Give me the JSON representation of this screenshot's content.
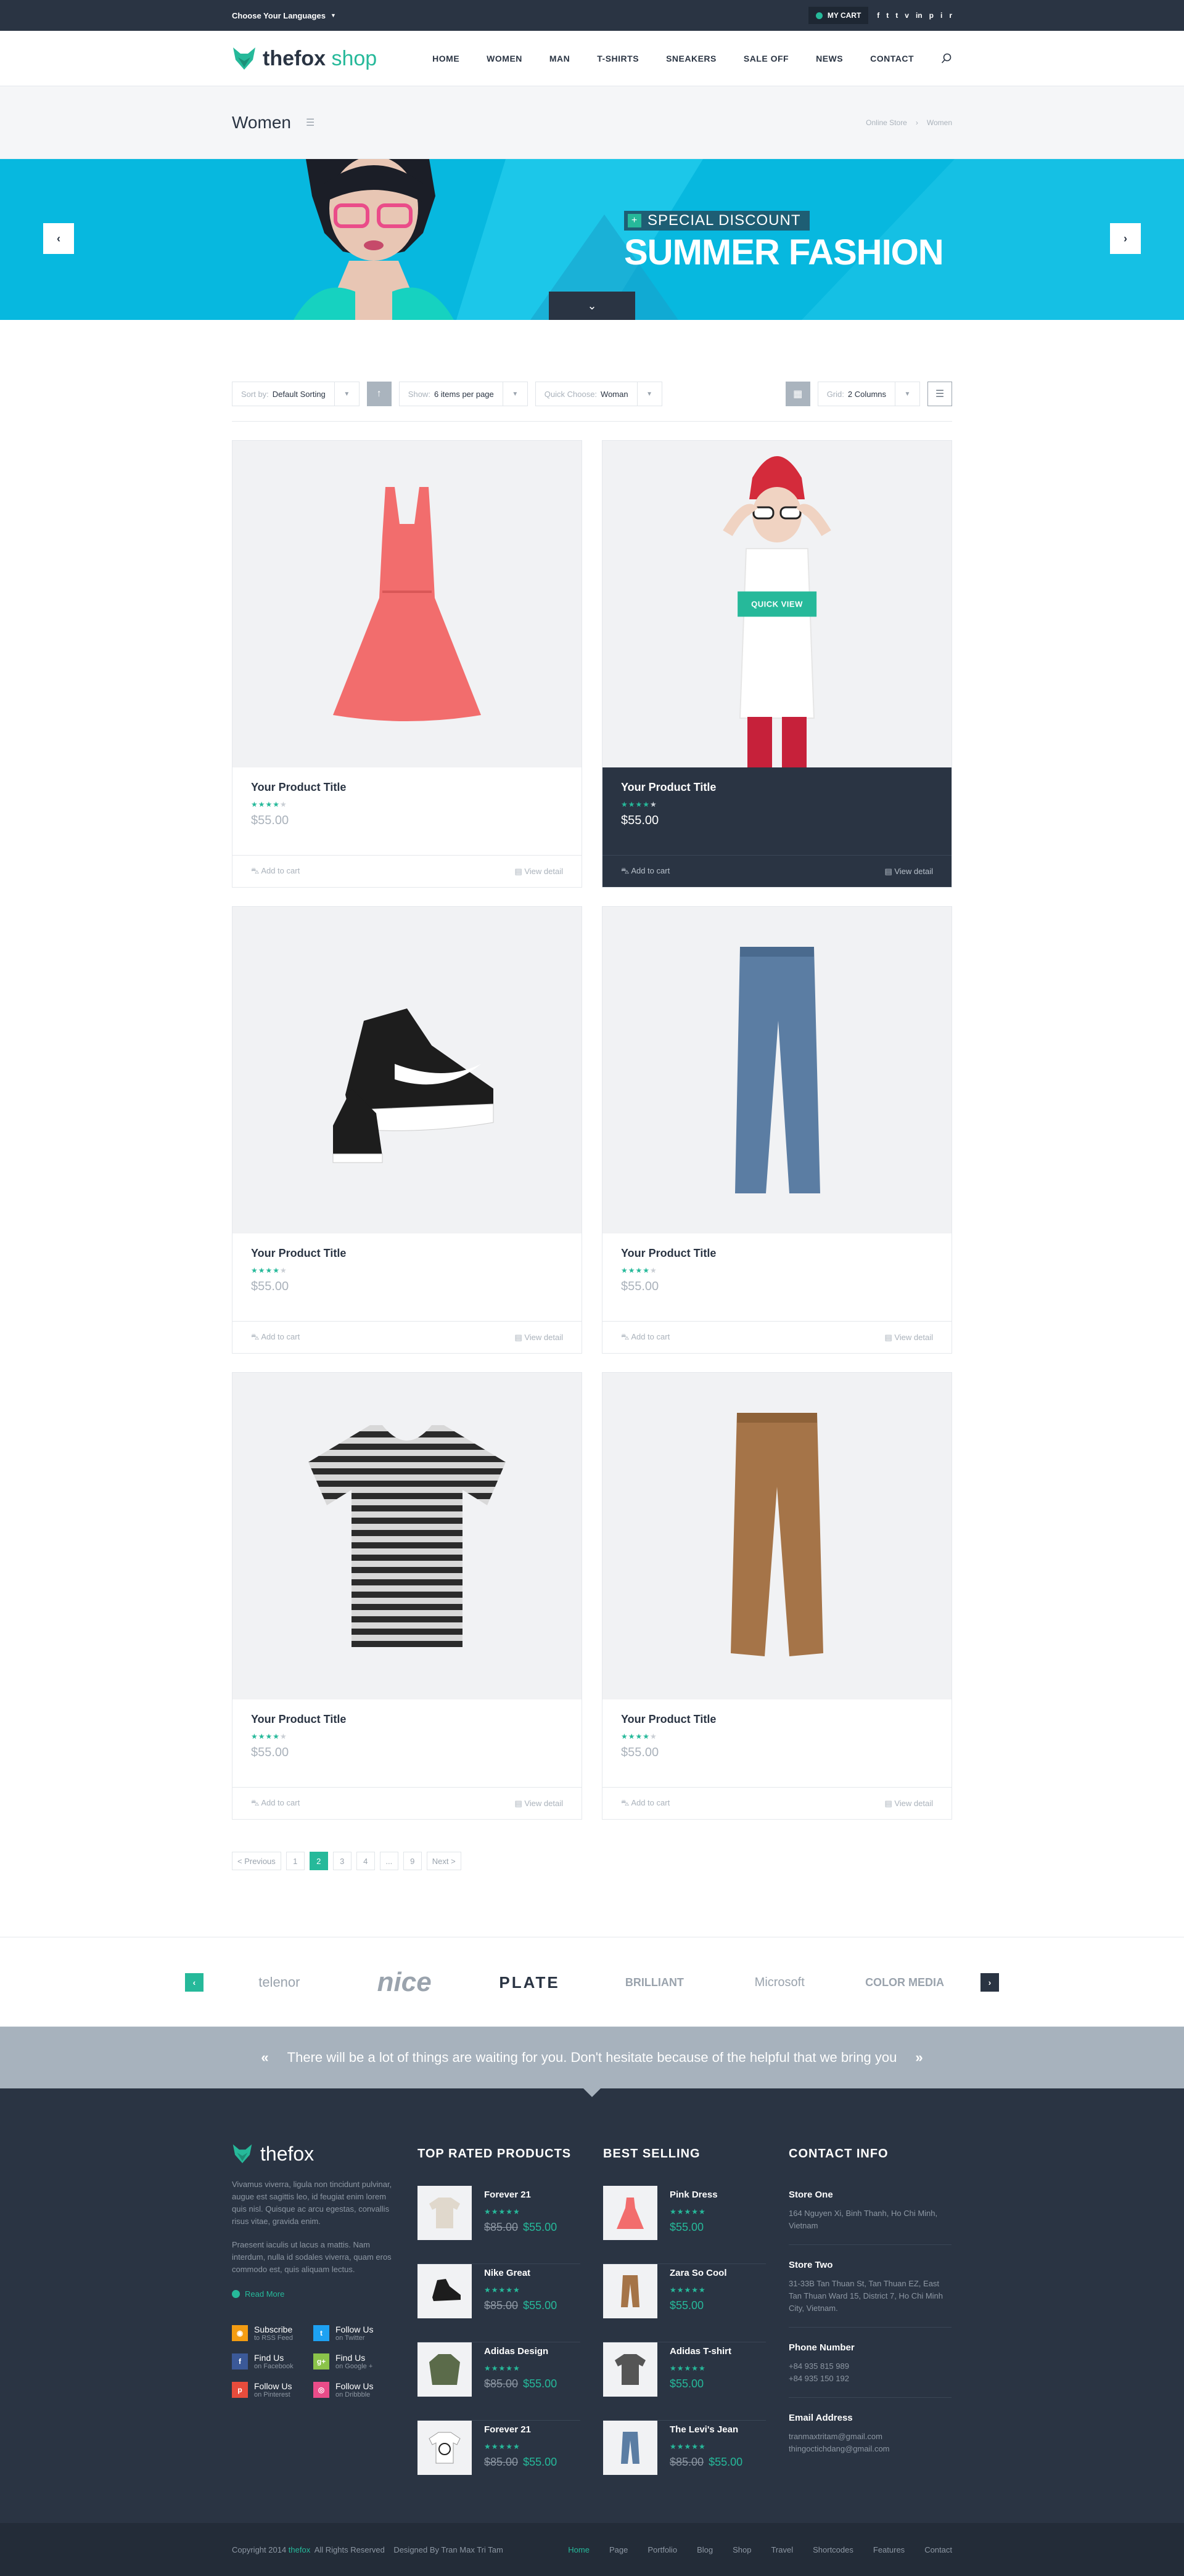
{
  "topbar": {
    "language": "Choose Your Languages",
    "cart": "MY CART",
    "socials": [
      "f",
      "t",
      "t",
      "v",
      "in",
      "p",
      "i",
      "r"
    ]
  },
  "header": {
    "logo_main": "thefox",
    "logo_sub": "shop",
    "nav": [
      "HOME",
      "WOMEN",
      "MAN",
      "T-SHIRTS",
      "SNEAKERS",
      "SALE OFF",
      "NEWS",
      "CONTACT"
    ]
  },
  "page_title": {
    "title": "Women",
    "breadcrumb": [
      "Online Store",
      "Women"
    ]
  },
  "banner": {
    "badge": "SPECIAL DISCOUNT",
    "title": "SUMMER FASHION"
  },
  "toolbar": {
    "sort_label": "Sort by:",
    "sort_value": "Default Sorting",
    "show_label": "Show:",
    "show_value": "6 items per page",
    "quick_label": "Quick Choose:",
    "quick_value": "Woman",
    "grid_label": "Grid:",
    "grid_value": "2 Columns"
  },
  "products": [
    {
      "title": "Your Product Title",
      "price": "$55.00",
      "rating": 4,
      "add": "Add to cart",
      "view": "View detail"
    },
    {
      "title": "Your Product Title",
      "price": "$55.00",
      "rating": 4,
      "add": "Add to cart",
      "view": "View detail",
      "quick_view": "QUICK VIEW"
    },
    {
      "title": "Your Product Title",
      "price": "$55.00",
      "rating": 4,
      "add": "Add to cart",
      "view": "View detail"
    },
    {
      "title": "Your Product Title",
      "price": "$55.00",
      "rating": 4,
      "add": "Add to cart",
      "view": "View detail"
    },
    {
      "title": "Your Product Title",
      "price": "$55.00",
      "rating": 4,
      "add": "Add to cart",
      "view": "View detail"
    },
    {
      "title": "Your Product Title",
      "price": "$55.00",
      "rating": 4,
      "add": "Add to cart",
      "view": "View detail"
    }
  ],
  "pagination": [
    "< Previous",
    "1",
    "2",
    "3",
    "4",
    "...",
    "9",
    "Next >"
  ],
  "brands": [
    "telenor",
    "nice",
    "PLATE",
    "BRILLIANT",
    "Microsoft",
    "COLOR MEDIA"
  ],
  "quote": "There will be a lot of things are waiting for you. Don't hesitate because of the helpful that we bring you",
  "footer": {
    "logo": "thefox",
    "about_1": "Vivamus viverra, ligula non tincidunt pulvinar, augue est sagittis leo, id feugiat enim lorem quis nisl. Quisque ac arcu egestas, convallis risus vitae, gravida enim.",
    "about_2": "Praesent iaculis ut lacus a mattis. Nam interdum, nulla id sodales viverra, quam eros commodo est, quis aliquam lectus.",
    "read_more": "Read More",
    "socials": [
      {
        "t1": "Subscribe",
        "t2": "to RSS Feed",
        "color": "#f39c12",
        "icon": "rss-icon"
      },
      {
        "t1": "Follow Us",
        "t2": "on Twitter",
        "color": "#1da1f2",
        "icon": "twitter-icon"
      },
      {
        "t1": "Find Us",
        "t2": "on Facebook",
        "color": "#3b5998",
        "icon": "facebook-icon"
      },
      {
        "t1": "Find Us",
        "t2": "on Google +",
        "color": "#8bc34a",
        "icon": "google-plus-icon"
      },
      {
        "t1": "Follow Us",
        "t2": "on Pinterest",
        "color": "#e74c3c",
        "icon": "pinterest-icon"
      },
      {
        "t1": "Follow Us",
        "t2": "on Dribbble",
        "color": "#ea4c89",
        "icon": "dribbble-icon"
      }
    ],
    "top_rated_title": "TOP RATED PRODUCTS",
    "top_rated": [
      {
        "name": "Forever 21",
        "old": "$85.00",
        "price": "$55.00"
      },
      {
        "name": "Nike Great",
        "old": "$85.00",
        "price": "$55.00"
      },
      {
        "name": "Adidas Design",
        "old": "$85.00",
        "price": "$55.00"
      },
      {
        "name": "Forever 21",
        "old": "$85.00",
        "price": "$55.00"
      }
    ],
    "best_selling_title": "BEST SELLING",
    "best_selling": [
      {
        "name": "Pink Dress",
        "old": "",
        "price": "$55.00"
      },
      {
        "name": "Zara So Cool",
        "old": "",
        "price": "$55.00"
      },
      {
        "name": "Adidas T-shirt",
        "old": "",
        "price": "$55.00"
      },
      {
        "name": "The Levi's Jean",
        "old": "$85.00",
        "price": "$55.00"
      }
    ],
    "contact_title": "CONTACT INFO",
    "contact": [
      {
        "label": "Store One",
        "value": "164 Nguyen Xi, Binh Thanh, Ho Chi Minh, Vietnam"
      },
      {
        "label": "Store Two",
        "value": "31-33B Tan Thuan St, Tan Thuan EZ, East Tan Thuan Ward 15, District 7, Ho Chi Minh City, Vietnam."
      },
      {
        "label": "Phone Number",
        "value": "+84 935 815 989\n+84 935 150 192"
      },
      {
        "label": "Email Address",
        "value": "tranmaxtritam@gmail.com\nthingoctichdang@gmail.com"
      }
    ]
  },
  "bottom": {
    "copy_pre": "Copyright 2014 ",
    "copy_brand": "thefox",
    "copy_post": "  All Rights Reserved    Designed By Tran Max Tri Tam",
    "nav": [
      "Home",
      "Page",
      "Portfolio",
      "Blog",
      "Shop",
      "Travel",
      "Shortcodes",
      "Features",
      "Contact"
    ]
  },
  "colors": {
    "accent": "#26b99a",
    "dark": "#2a3443",
    "banner": "#07b8df"
  }
}
